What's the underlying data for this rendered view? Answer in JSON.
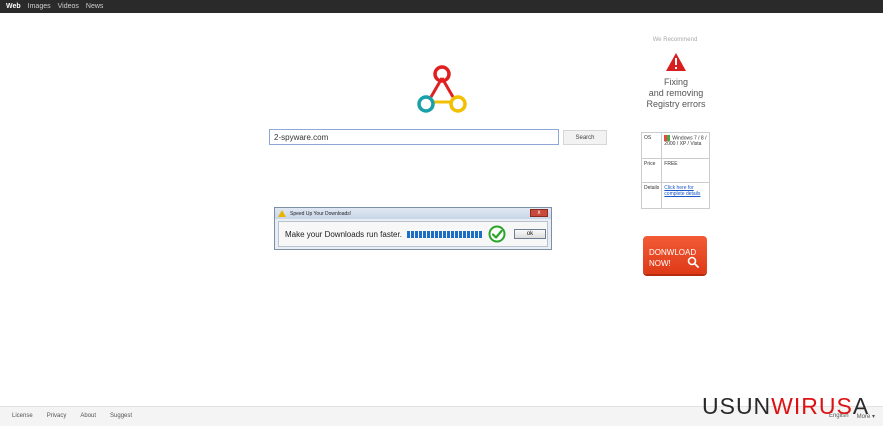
{
  "topbar": {
    "tabs": [
      {
        "label": "Web",
        "active": true
      },
      {
        "label": "Images",
        "active": false
      },
      {
        "label": "Videos",
        "active": false
      },
      {
        "label": "News",
        "active": false
      }
    ]
  },
  "logo": {
    "icon": "triangle-circles-logo",
    "colors": [
      "#e02020",
      "#1aa0a8",
      "#f2c000"
    ]
  },
  "search": {
    "value": "2-spyware.com",
    "button_label": "Search"
  },
  "popup": {
    "title": "Speed Up Your Downloads!",
    "message": "Make your Downloads run faster.",
    "progress_blocks": 19,
    "ok_label": "ok",
    "close_label": "x"
  },
  "sidebar": {
    "recommend": "We Recommend",
    "fix_line1": "Fixing",
    "fix_line2": "and removing",
    "fix_line3": "Registry errors",
    "table": {
      "os_key": "OS",
      "os_value": "Windows 7 / 8 / 2000 / XP / Vista",
      "price_key": "Price",
      "price_value": "FREE",
      "details_key": "Details",
      "details_value": "Click here for complete details"
    },
    "download_line1": "DONWLOAD",
    "download_line2": "NOW!"
  },
  "footer": {
    "links": [
      "License",
      "Privacy",
      "About",
      "Suggest"
    ],
    "language": "English",
    "more": "More ▾"
  },
  "watermark": {
    "part1": "USUN",
    "part2": "WIRUS",
    "part3": "A"
  }
}
